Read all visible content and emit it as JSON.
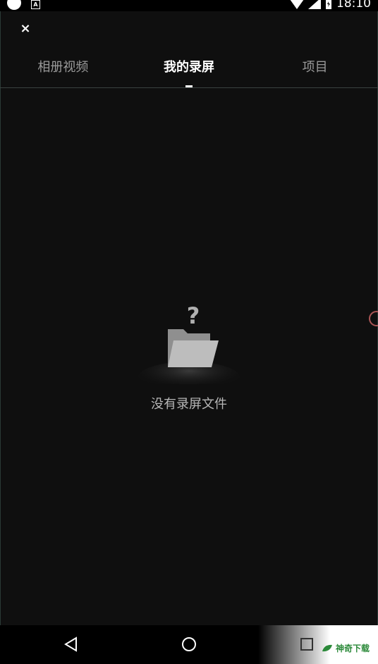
{
  "status_bar": {
    "time": "18:10",
    "left_icons": [
      "circle-icon",
      "a-icon"
    ],
    "a_icon_label": "A",
    "right_icons": [
      "wifi-icon",
      "signal-icon",
      "battery-icon"
    ]
  },
  "header": {
    "close_label": "×"
  },
  "tabs": [
    {
      "label": "相册视频",
      "active": false
    },
    {
      "label": "我的录屏",
      "active": true
    },
    {
      "label": "项目",
      "active": false
    }
  ],
  "empty_state": {
    "icon": "folder-question-icon",
    "message": "没有录屏文件"
  },
  "nav_bar": {
    "icons": [
      "back-icon",
      "home-icon",
      "recents-icon"
    ]
  },
  "watermark": {
    "text": "神奇下载"
  },
  "colors": {
    "background": "#0f0f0f",
    "tab_inactive": "#9a9a9a",
    "tab_active": "#ffffff",
    "empty_text": "#b7b7b7",
    "folder": "#b0b0b0"
  }
}
